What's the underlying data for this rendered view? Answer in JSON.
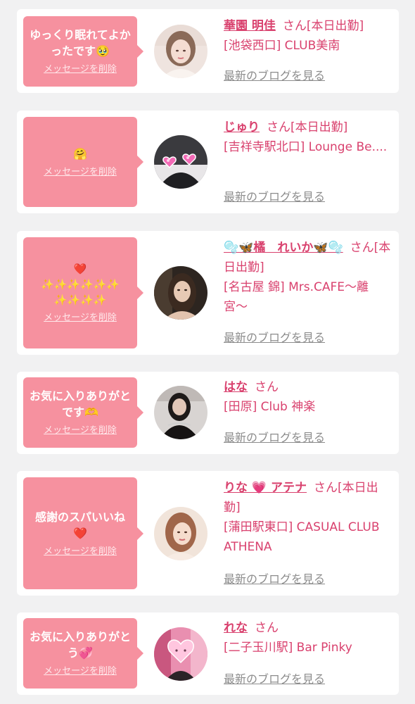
{
  "colors": {
    "background": "#f1f1f2",
    "card": "#ffffff",
    "bubble": "#f6919f",
    "name": "#d9416e",
    "blog_link": "#8c8c8c"
  },
  "favorites": [
    {
      "message": "ゆっくり眠れてよかったです🥹",
      "delete_label": "メッセージを削除",
      "name": "華園 明佳",
      "suffix": "さん[本日出勤]",
      "shop": "[池袋西口] CLUB美南",
      "blog_label": "最新のブログを見る",
      "avatar_icon": "woman-photo-light"
    },
    {
      "message": "🤗",
      "delete_label": "メッセージを削除",
      "name": "じゅり",
      "suffix": "さん[本日出勤]",
      "shop": "[吉祥寺駅北口] Lounge Be....",
      "blog_label": "最新のブログを見る",
      "avatar_icon": "hearts-covered-photo"
    },
    {
      "message": "❤️\n✨✨✨✨✨✨\n✨✨✨✨",
      "delete_label": "メッセージを削除",
      "name": "🫧🦋橘　れいか🦋🫧",
      "suffix": "さん[本日出勤]",
      "shop": "[名古屋 錦] Mrs.CAFE〜離宮〜",
      "blog_label": "最新のブログを見る",
      "avatar_icon": "woman-photo-dark"
    },
    {
      "message": "お気に入りありがとです🫶",
      "delete_label": "メッセージを削除",
      "name": "はな",
      "suffix": "さん",
      "shop": "[田原] Club 神楽",
      "blog_label": "最新のブログを見る",
      "avatar_icon": "woman-photo-black-dress"
    },
    {
      "message": "感謝のスパいいね❤️",
      "delete_label": "メッセージを削除",
      "name": "りな 💗 アテナ",
      "suffix": "さん[本日出勤]",
      "shop": "[蒲田駅東口] CASUAL CLUB ATHENA",
      "blog_label": "最新のブログを見る",
      "avatar_icon": "woman-photo-warm"
    },
    {
      "message": "お気に入りありがとう💞",
      "delete_label": "メッセージを削除",
      "name": "れな",
      "suffix": "さん",
      "shop": "[二子玉川駅] Bar Pinky",
      "blog_label": "最新のブログを見る",
      "avatar_icon": "heart-face-photo"
    }
  ]
}
